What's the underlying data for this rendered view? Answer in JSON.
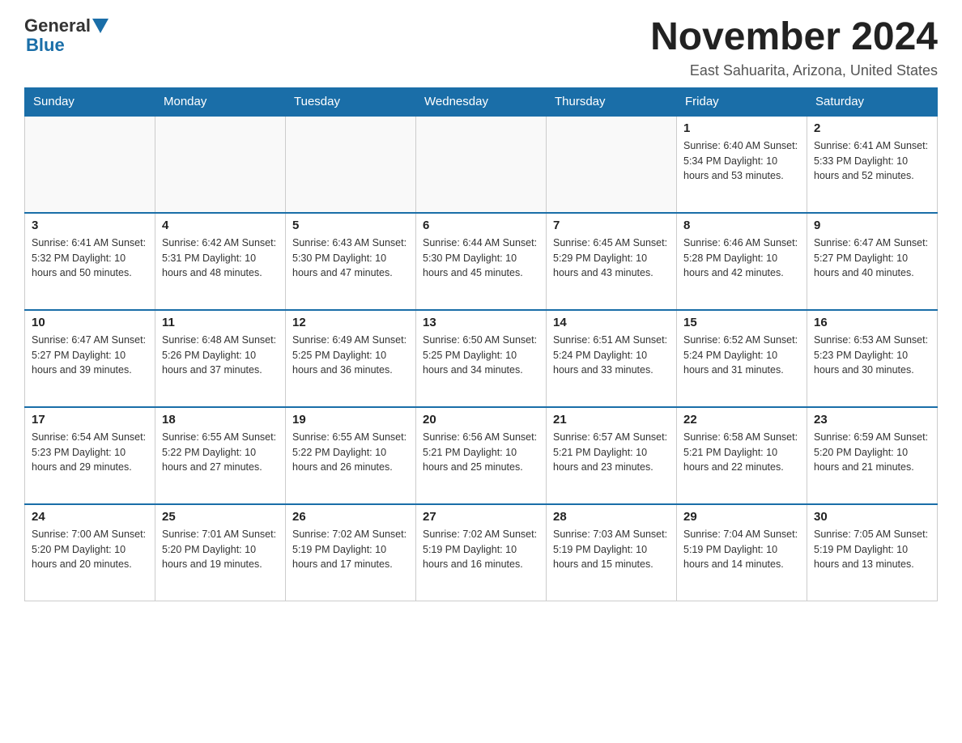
{
  "logo": {
    "general": "General",
    "blue": "Blue"
  },
  "header": {
    "month_year": "November 2024",
    "location": "East Sahuarita, Arizona, United States"
  },
  "days_of_week": [
    "Sunday",
    "Monday",
    "Tuesday",
    "Wednesday",
    "Thursday",
    "Friday",
    "Saturday"
  ],
  "weeks": [
    {
      "days": [
        {
          "num": "",
          "info": ""
        },
        {
          "num": "",
          "info": ""
        },
        {
          "num": "",
          "info": ""
        },
        {
          "num": "",
          "info": ""
        },
        {
          "num": "",
          "info": ""
        },
        {
          "num": "1",
          "info": "Sunrise: 6:40 AM\nSunset: 5:34 PM\nDaylight: 10 hours and 53 minutes."
        },
        {
          "num": "2",
          "info": "Sunrise: 6:41 AM\nSunset: 5:33 PM\nDaylight: 10 hours and 52 minutes."
        }
      ]
    },
    {
      "days": [
        {
          "num": "3",
          "info": "Sunrise: 6:41 AM\nSunset: 5:32 PM\nDaylight: 10 hours and 50 minutes."
        },
        {
          "num": "4",
          "info": "Sunrise: 6:42 AM\nSunset: 5:31 PM\nDaylight: 10 hours and 48 minutes."
        },
        {
          "num": "5",
          "info": "Sunrise: 6:43 AM\nSunset: 5:30 PM\nDaylight: 10 hours and 47 minutes."
        },
        {
          "num": "6",
          "info": "Sunrise: 6:44 AM\nSunset: 5:30 PM\nDaylight: 10 hours and 45 minutes."
        },
        {
          "num": "7",
          "info": "Sunrise: 6:45 AM\nSunset: 5:29 PM\nDaylight: 10 hours and 43 minutes."
        },
        {
          "num": "8",
          "info": "Sunrise: 6:46 AM\nSunset: 5:28 PM\nDaylight: 10 hours and 42 minutes."
        },
        {
          "num": "9",
          "info": "Sunrise: 6:47 AM\nSunset: 5:27 PM\nDaylight: 10 hours and 40 minutes."
        }
      ]
    },
    {
      "days": [
        {
          "num": "10",
          "info": "Sunrise: 6:47 AM\nSunset: 5:27 PM\nDaylight: 10 hours and 39 minutes."
        },
        {
          "num": "11",
          "info": "Sunrise: 6:48 AM\nSunset: 5:26 PM\nDaylight: 10 hours and 37 minutes."
        },
        {
          "num": "12",
          "info": "Sunrise: 6:49 AM\nSunset: 5:25 PM\nDaylight: 10 hours and 36 minutes."
        },
        {
          "num": "13",
          "info": "Sunrise: 6:50 AM\nSunset: 5:25 PM\nDaylight: 10 hours and 34 minutes."
        },
        {
          "num": "14",
          "info": "Sunrise: 6:51 AM\nSunset: 5:24 PM\nDaylight: 10 hours and 33 minutes."
        },
        {
          "num": "15",
          "info": "Sunrise: 6:52 AM\nSunset: 5:24 PM\nDaylight: 10 hours and 31 minutes."
        },
        {
          "num": "16",
          "info": "Sunrise: 6:53 AM\nSunset: 5:23 PM\nDaylight: 10 hours and 30 minutes."
        }
      ]
    },
    {
      "days": [
        {
          "num": "17",
          "info": "Sunrise: 6:54 AM\nSunset: 5:23 PM\nDaylight: 10 hours and 29 minutes."
        },
        {
          "num": "18",
          "info": "Sunrise: 6:55 AM\nSunset: 5:22 PM\nDaylight: 10 hours and 27 minutes."
        },
        {
          "num": "19",
          "info": "Sunrise: 6:55 AM\nSunset: 5:22 PM\nDaylight: 10 hours and 26 minutes."
        },
        {
          "num": "20",
          "info": "Sunrise: 6:56 AM\nSunset: 5:21 PM\nDaylight: 10 hours and 25 minutes."
        },
        {
          "num": "21",
          "info": "Sunrise: 6:57 AM\nSunset: 5:21 PM\nDaylight: 10 hours and 23 minutes."
        },
        {
          "num": "22",
          "info": "Sunrise: 6:58 AM\nSunset: 5:21 PM\nDaylight: 10 hours and 22 minutes."
        },
        {
          "num": "23",
          "info": "Sunrise: 6:59 AM\nSunset: 5:20 PM\nDaylight: 10 hours and 21 minutes."
        }
      ]
    },
    {
      "days": [
        {
          "num": "24",
          "info": "Sunrise: 7:00 AM\nSunset: 5:20 PM\nDaylight: 10 hours and 20 minutes."
        },
        {
          "num": "25",
          "info": "Sunrise: 7:01 AM\nSunset: 5:20 PM\nDaylight: 10 hours and 19 minutes."
        },
        {
          "num": "26",
          "info": "Sunrise: 7:02 AM\nSunset: 5:19 PM\nDaylight: 10 hours and 17 minutes."
        },
        {
          "num": "27",
          "info": "Sunrise: 7:02 AM\nSunset: 5:19 PM\nDaylight: 10 hours and 16 minutes."
        },
        {
          "num": "28",
          "info": "Sunrise: 7:03 AM\nSunset: 5:19 PM\nDaylight: 10 hours and 15 minutes."
        },
        {
          "num": "29",
          "info": "Sunrise: 7:04 AM\nSunset: 5:19 PM\nDaylight: 10 hours and 14 minutes."
        },
        {
          "num": "30",
          "info": "Sunrise: 7:05 AM\nSunset: 5:19 PM\nDaylight: 10 hours and 13 minutes."
        }
      ]
    }
  ]
}
